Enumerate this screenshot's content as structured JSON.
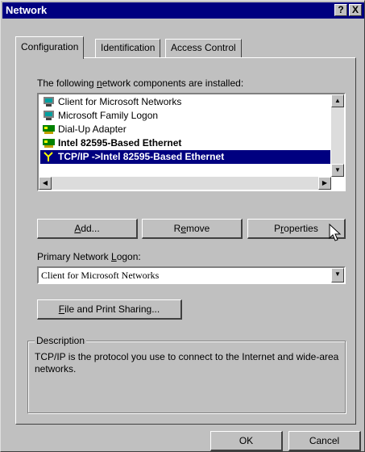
{
  "window": {
    "title": "Network",
    "help_glyph": "?",
    "close_glyph": "X"
  },
  "tabs": [
    {
      "label": "Configuration",
      "active": true
    },
    {
      "label": "Identification",
      "active": false
    },
    {
      "label": "Access Control",
      "active": false
    }
  ],
  "components": {
    "label_pre": "The following ",
    "label_key": "n",
    "label_post": "etwork components are installed:",
    "items": [
      {
        "label": "Client for Microsoft Networks",
        "icon": "computer-icon"
      },
      {
        "label": "Microsoft Family Logon",
        "icon": "computer-icon"
      },
      {
        "label": "Dial-Up Adapter",
        "icon": "network-adapter-icon"
      },
      {
        "label": "Intel 82595-Based Ethernet",
        "icon": "network-adapter-icon"
      },
      {
        "label": "TCP/IP ->Intel 82595-Based Ethernet",
        "icon": "protocol-icon",
        "selected": true
      }
    ]
  },
  "buttons": {
    "add_key": "A",
    "add_rest": "dd...",
    "remove_pre": "R",
    "remove_key": "e",
    "remove_rest": "move",
    "properties_pre": "P",
    "properties_key": "r",
    "properties_rest": "operties"
  },
  "logon": {
    "label_pre": "Primary Network ",
    "label_key": "L",
    "label_post": "ogon:",
    "value": "Client for Microsoft Networks"
  },
  "sharing": {
    "key": "F",
    "rest": "ile and Print Sharing..."
  },
  "description": {
    "title": "Description",
    "text": "TCP/IP is the protocol you use to connect to the Internet and wide-area networks."
  },
  "footer": {
    "ok": "OK",
    "cancel": "Cancel"
  },
  "colors": {
    "titlebar": "#000080",
    "face": "#c0c0c0",
    "selection": "#000080"
  }
}
